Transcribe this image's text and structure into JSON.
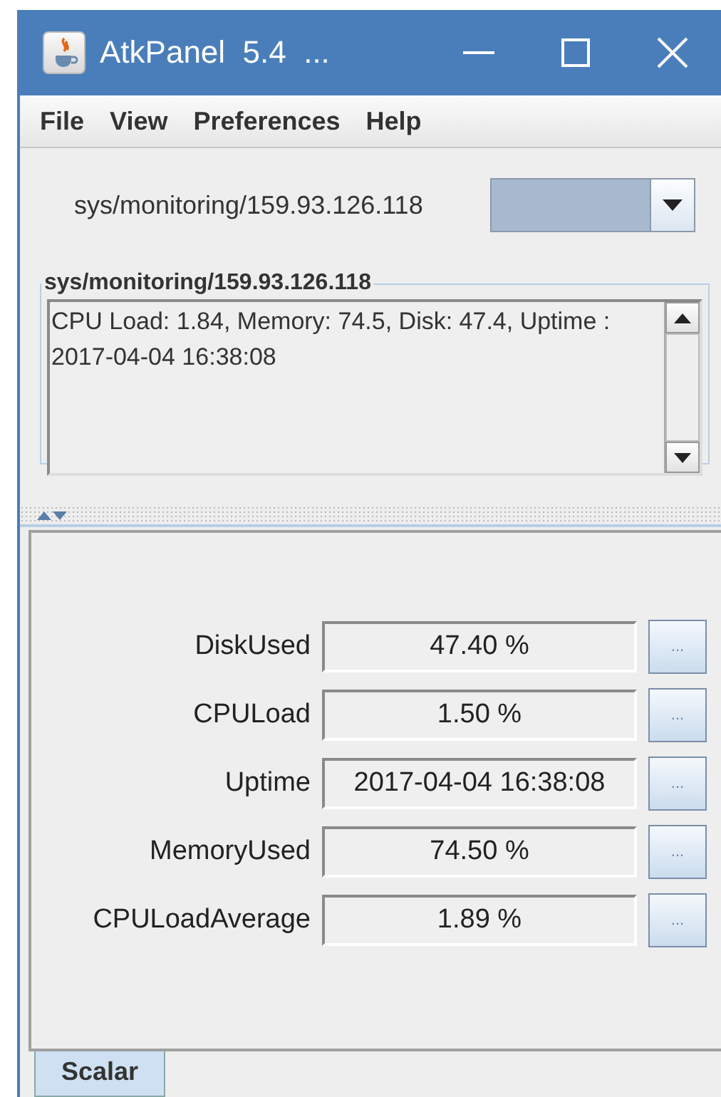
{
  "window": {
    "title": "AtkPanel  5.4  ..."
  },
  "menu": [
    "File",
    "View",
    "Preferences",
    "Help"
  ],
  "device": {
    "label": "sys/monitoring/159.93.126.118"
  },
  "status": {
    "title": "sys/monitoring/159.93.126.118",
    "text": "CPU Load: 1.84, Memory: 74.5, Disk: 47.4, Uptime : 2017-04-04 16:38:08"
  },
  "attributes": [
    {
      "name": "DiskUsed",
      "value": "47.40 %",
      "button": "..."
    },
    {
      "name": "CPULoad",
      "value": "1.50 %",
      "button": "..."
    },
    {
      "name": "Uptime",
      "value": "2017-04-04 16:38:08",
      "button": "..."
    },
    {
      "name": "MemoryUsed",
      "value": "74.50 %",
      "button": "..."
    },
    {
      "name": "CPULoadAverage",
      "value": "1.89 %",
      "button": "..."
    }
  ],
  "tabs": [
    {
      "label": "Scalar",
      "selected": true
    }
  ]
}
